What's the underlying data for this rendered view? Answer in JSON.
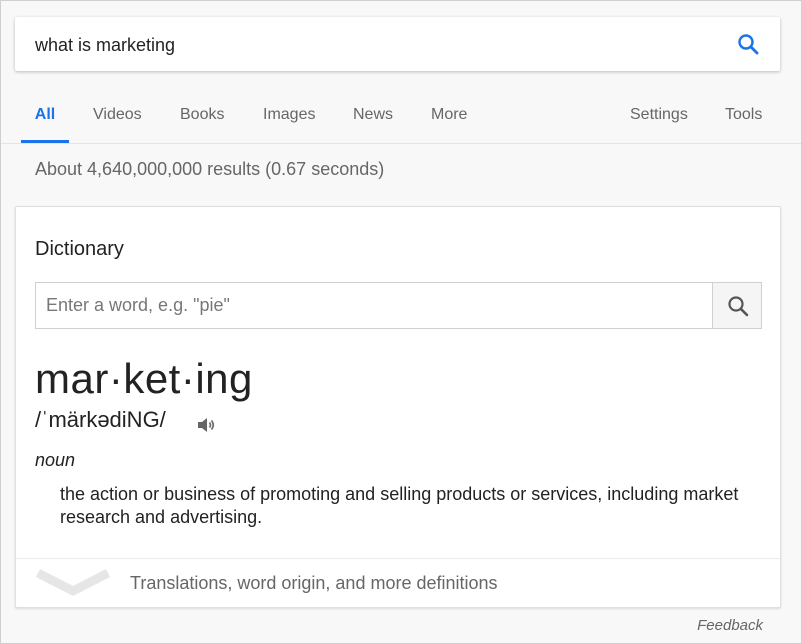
{
  "search": {
    "query": "what is marketing"
  },
  "tabs": [
    {
      "label": "All"
    },
    {
      "label": "Videos"
    },
    {
      "label": "Books"
    },
    {
      "label": "Images"
    },
    {
      "label": "News"
    },
    {
      "label": "More"
    }
  ],
  "tools": {
    "settings_label": "Settings",
    "tools_label": "Tools"
  },
  "result_stats": "About 4,640,000,000 results (0.67 seconds)",
  "dictionary": {
    "title": "Dictionary",
    "input_placeholder": "Enter a word, e.g. \"pie\"",
    "word": "mar·ket·ing",
    "pronunciation": "/ˈmärkədiNG/",
    "part_of_speech": "noun",
    "definition": "the action or business of promoting and selling products or services, including market research and advertising.",
    "footer_text": "Translations, word origin, and more definitions"
  },
  "feedback_label": "Feedback",
  "colors": {
    "accent": "#1a73e8",
    "muted_text": "#666666"
  }
}
